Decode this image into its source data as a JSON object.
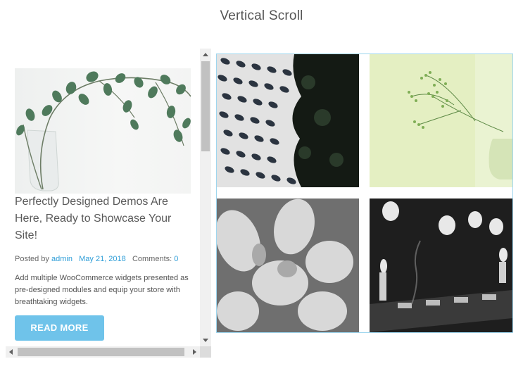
{
  "page": {
    "title": "Vertical Scroll"
  },
  "post": {
    "image_icon": "plant-in-vase-image",
    "title": "Perfectly Designed Demos Are Here, Ready to Showcase Your Site!",
    "meta": {
      "posted_by_label": "Posted by",
      "author": "admin",
      "date": "May 21, 2018",
      "comments_label": "Comments:",
      "comments_count": "0"
    },
    "excerpt": "Add multiple WooCommerce widgets presented as pre-designed modules and equip your store with breathtaking widgets.",
    "read_more_label": "READ MORE"
  },
  "gallery": {
    "images": [
      {
        "icon": "perforated-facade-image"
      },
      {
        "icon": "baby-breath-flowers-image"
      },
      {
        "icon": "monochrome-flowers-image"
      },
      {
        "icon": "candles-image"
      }
    ]
  },
  "colors": {
    "accent": "#6fc3ea",
    "link": "#2f9ed8",
    "gallery_border": "#9fd6ee"
  }
}
